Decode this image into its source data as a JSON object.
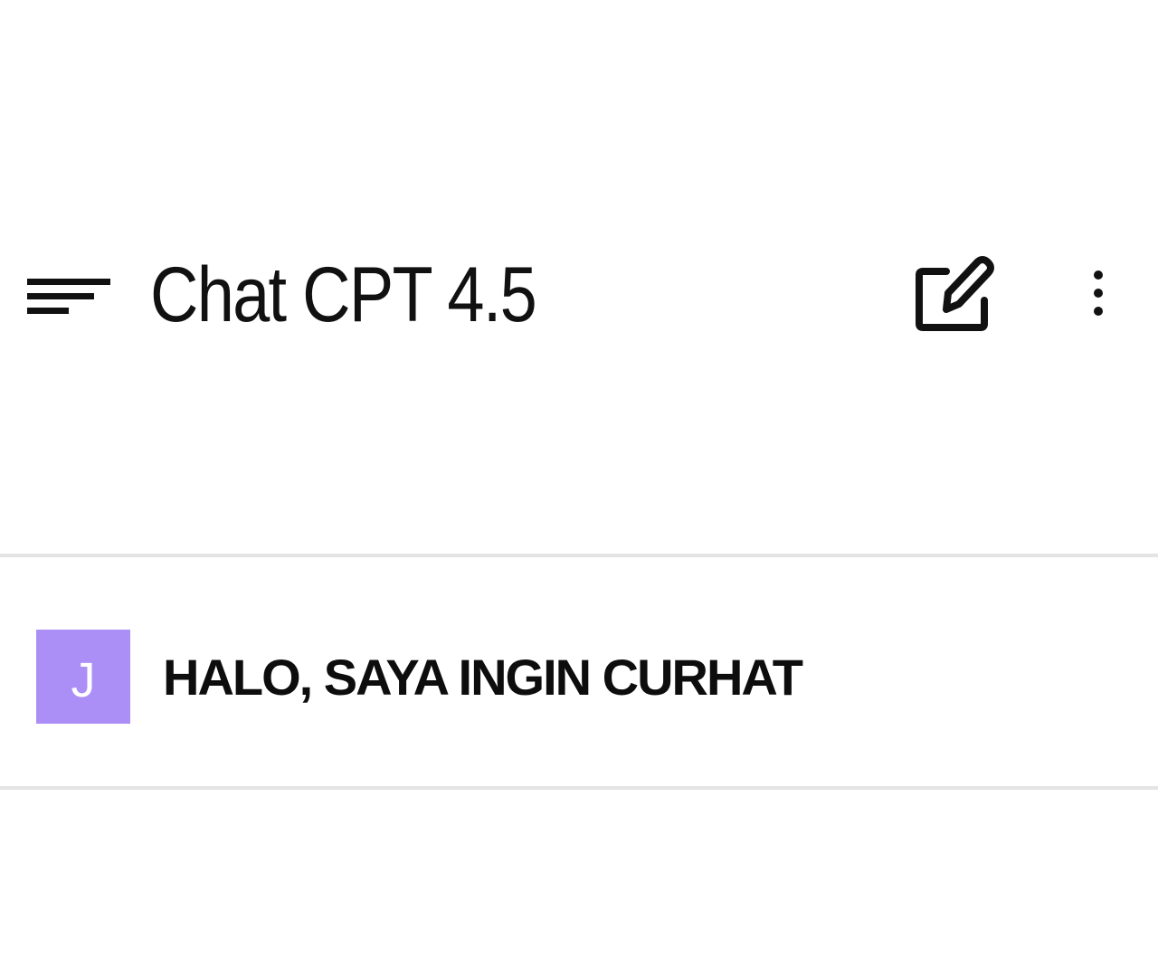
{
  "header": {
    "title": "Chat CPT 4.5",
    "menu_icon": "hamburger-menu-icon",
    "new_chat_icon": "edit-square-icon",
    "more_icon": "vertical-dots-icon"
  },
  "conversation": {
    "messages": [
      {
        "avatar_initial": "J",
        "text": "HALO, SAYA INGIN CURHAT"
      }
    ]
  },
  "colors": {
    "avatar_background": "#ab8ff6",
    "divider": "#e4e4e4",
    "text": "#111111"
  }
}
